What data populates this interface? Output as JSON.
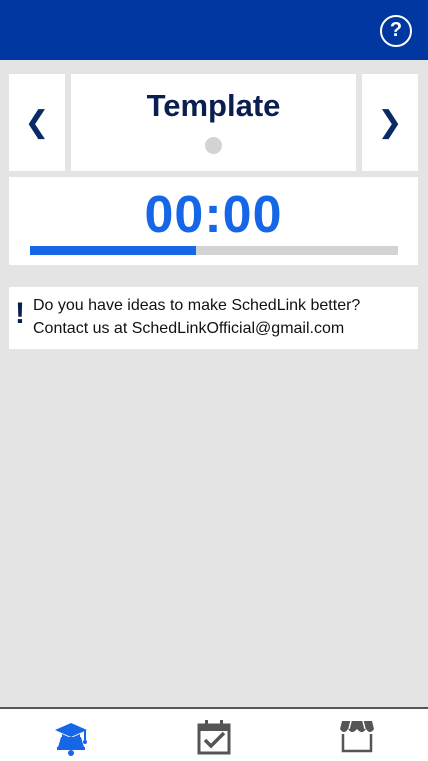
{
  "header": {
    "help_label": "?"
  },
  "nav": {
    "prev_label": "❮",
    "next_label": "❯"
  },
  "template": {
    "title": "Template"
  },
  "timer": {
    "display": "00:00",
    "progress": 0.45
  },
  "info": {
    "icon_label": "!",
    "line1": "Do you have ideas to make SchedLink better?",
    "line2": "Contact us at SchedLinkOfficial@gmail.com"
  },
  "tabs": [
    {
      "icon": "graduation-bell-icon",
      "color": "#1666e8",
      "active": true
    },
    {
      "icon": "calendar-check-icon",
      "color": "#555555",
      "active": false
    },
    {
      "icon": "store-icon",
      "color": "#555555",
      "active": false
    }
  ]
}
